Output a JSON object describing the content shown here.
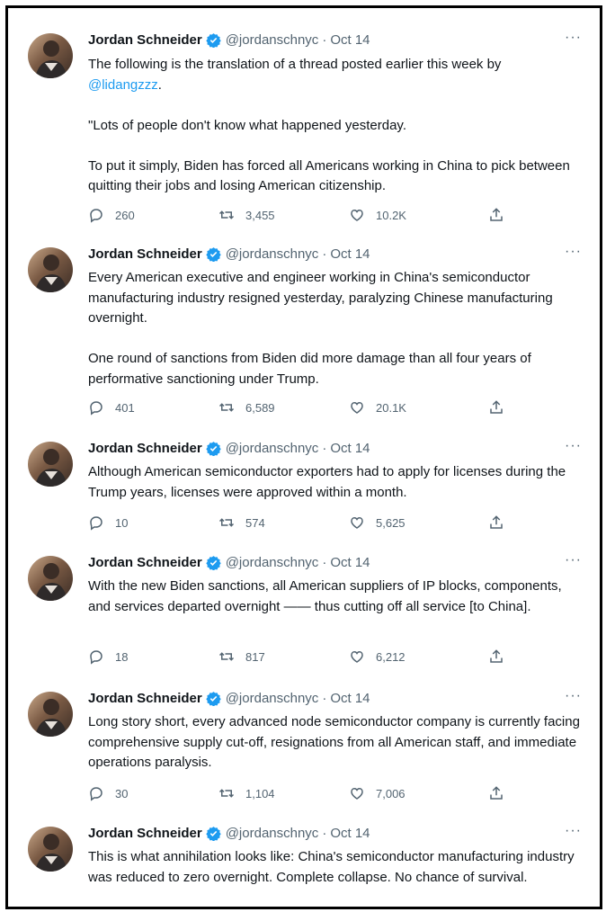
{
  "tweets": [
    {
      "author": "Jordan Schneider",
      "handle": "@jordanschnyc",
      "date": "Oct 14",
      "text_prefix": "The following is the translation of a thread posted earlier this week by",
      "mention": "@lidangzzz",
      "text_suffix": ".",
      "text": "\"Lots of people don't know what happened yesterday.\n\nTo put it simply, Biden has forced all Americans working in China to pick between quitting their jobs and losing American citizenship.",
      "replies": "260",
      "retweets": "3,455",
      "likes": "10.2K"
    },
    {
      "author": "Jordan Schneider",
      "handle": "@jordanschnyc",
      "date": "Oct 14",
      "text": "Every American executive and engineer working in China's semiconductor manufacturing industry resigned yesterday, paralyzing Chinese manufacturing overnight.\n\nOne round of sanctions from Biden did more damage than all four years of performative sanctioning under Trump.",
      "replies": "401",
      "retweets": "6,589",
      "likes": "20.1K"
    },
    {
      "author": "Jordan Schneider",
      "handle": "@jordanschnyc",
      "date": "Oct 14",
      "text": "Although American semiconductor exporters had to apply for licenses during the Trump years, licenses were approved within a month.",
      "replies": "10",
      "retweets": "574",
      "likes": "5,625"
    },
    {
      "author": "Jordan Schneider",
      "handle": "@jordanschnyc",
      "date": "Oct 14",
      "text": "With the new Biden sanctions, all American suppliers of IP blocks, components, and services departed overnight —— thus cutting off all service [to China].",
      "replies": "18",
      "retweets": "817",
      "likes": "6,212"
    },
    {
      "author": "Jordan Schneider",
      "handle": "@jordanschnyc",
      "date": "Oct 14",
      "text": "Long story short, every advanced node semiconductor company is currently facing comprehensive supply cut-off, resignations from all American staff, and immediate operations paralysis.",
      "replies": "30",
      "retweets": "1,104",
      "likes": "7,006"
    },
    {
      "author": "Jordan Schneider",
      "handle": "@jordanschnyc",
      "date": "Oct 14",
      "text": "This is what annihilation looks like: China's semiconductor manufacturing industry was reduced to zero overnight. Complete collapse. No chance of survival."
    }
  ],
  "ui": {
    "separator": "·",
    "more": "···"
  },
  "icons": [
    "verified-badge-icon",
    "reply-icon",
    "retweet-icon",
    "like-icon",
    "share-icon",
    "more-icon"
  ],
  "colors": {
    "accent": "#1d9bf0",
    "text": "#0f1419",
    "muted": "#536471"
  }
}
